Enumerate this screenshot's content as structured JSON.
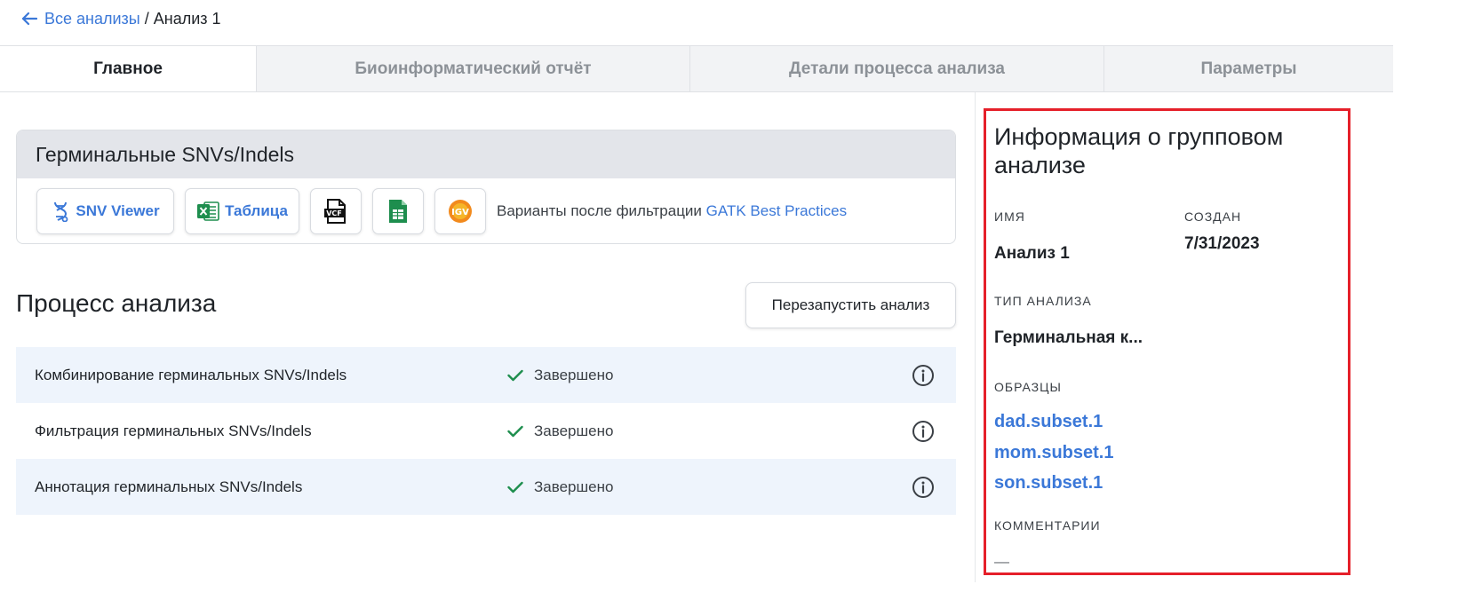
{
  "breadcrumb": {
    "back_label": "Все анализы",
    "separator": "/",
    "current": "Анализ 1"
  },
  "tabs": [
    {
      "label": "Главное",
      "active": true
    },
    {
      "label": "Биоинформатический отчёт",
      "active": false
    },
    {
      "label": "Детали процесса анализа",
      "active": false
    },
    {
      "label": "Параметры",
      "active": false
    }
  ],
  "germline_card": {
    "title": "Герминальные SNVs/Indels",
    "snv_viewer_label": "SNV Viewer",
    "table_label": "Таблица",
    "vcf_icon_text": "VCF",
    "igv_icon_text": "IGV",
    "description_prefix": "Варианты после фильтрации",
    "description_link": "GATK Best Practices"
  },
  "process": {
    "title": "Процесс анализа",
    "restart_label": "Перезапустить анализ",
    "steps": [
      {
        "name": "Комбинирование герминальных SNVs/Indels",
        "status": "Завершено"
      },
      {
        "name": "Фильтрация герминальных SNVs/Indels",
        "status": "Завершено"
      },
      {
        "name": "Аннотация герминальных SNVs/Indels",
        "status": "Завершено"
      }
    ]
  },
  "info_panel": {
    "title": "Информация о групповом анализе",
    "name_label": "Имя",
    "name_value": "Анализ 1",
    "created_label": "Создан",
    "created_value": "7/31/2023",
    "type_label": "Тип анализа",
    "type_value": "Герминальная к...",
    "samples_label": "Образцы",
    "samples": [
      "dad.subset.1",
      "mom.subset.1",
      "son.subset.1"
    ],
    "comments_label": "Комментарии",
    "comments_value": "—"
  },
  "colors": {
    "accent": "#3b78d8",
    "success": "#1e8e4e",
    "highlight_border": "#e5202a",
    "row_shade": "#eef4fc"
  },
  "icons": [
    "arrow-left-icon",
    "dna-icon",
    "excel-icon",
    "vcf-file-icon",
    "sheet-icon",
    "igv-icon",
    "check-icon",
    "info-icon"
  ]
}
